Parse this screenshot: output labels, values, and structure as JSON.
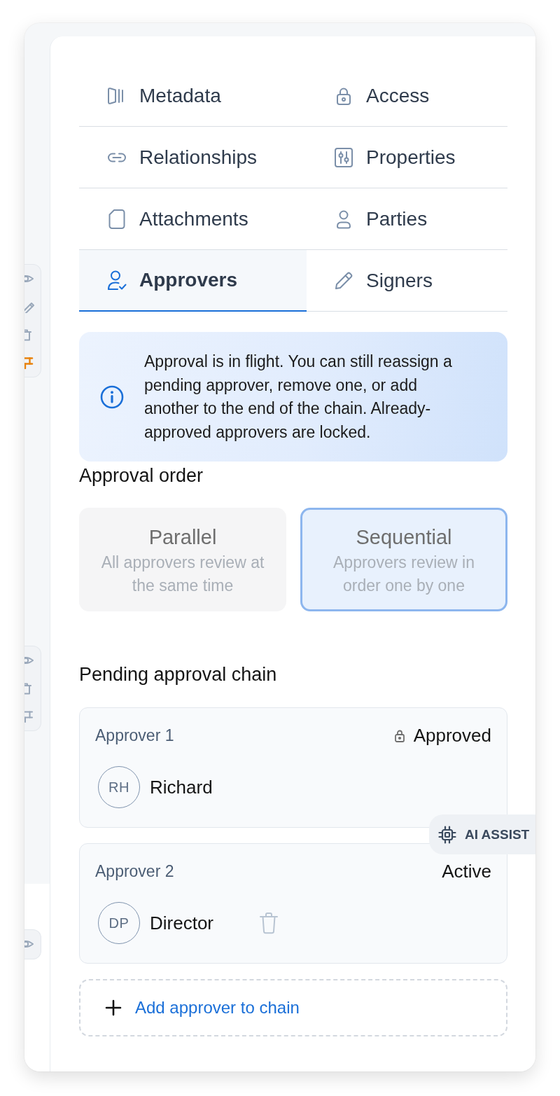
{
  "side_toolbars": [
    {
      "kind": "full",
      "pinned": true
    },
    {
      "kind": "compact",
      "pinned": false
    },
    {
      "kind": "view"
    }
  ],
  "tabs": [
    {
      "label": "Metadata",
      "selected": false
    },
    {
      "label": "Access",
      "selected": false
    },
    {
      "label": "Relationships",
      "selected": false
    },
    {
      "label": "Properties",
      "selected": false
    },
    {
      "label": "Attachments",
      "selected": false
    },
    {
      "label": "Parties",
      "selected": false
    },
    {
      "label": "Approvers",
      "selected": true
    },
    {
      "label": "Signers",
      "selected": false
    }
  ],
  "info_banner": {
    "text": "Approval is in flight. You can still reassign a pending approver, remove one, or add another to the end of the chain. Already-approved approvers are locked."
  },
  "approval_order": {
    "title": "Approval order",
    "disabled": true,
    "options": [
      {
        "label": "Parallel",
        "description": "All approvers review at the same time",
        "selected": false
      },
      {
        "label": "Sequential",
        "description": "Approvers review in order one by one",
        "selected": true
      }
    ]
  },
  "approval_chain": {
    "title": "Pending approval chain",
    "approvers": [
      {
        "label": "Approver 1",
        "status": "Approved",
        "locked": true,
        "initials": "RH",
        "name": "Richard",
        "removable": false
      },
      {
        "label": "Approver 2",
        "status": "Active",
        "locked": false,
        "initials": "DP",
        "name": "Director",
        "removable": true
      }
    ],
    "add_button": {
      "label": "Add approver to chain"
    }
  },
  "ai_assist": {
    "label": "AI ASSIST"
  }
}
